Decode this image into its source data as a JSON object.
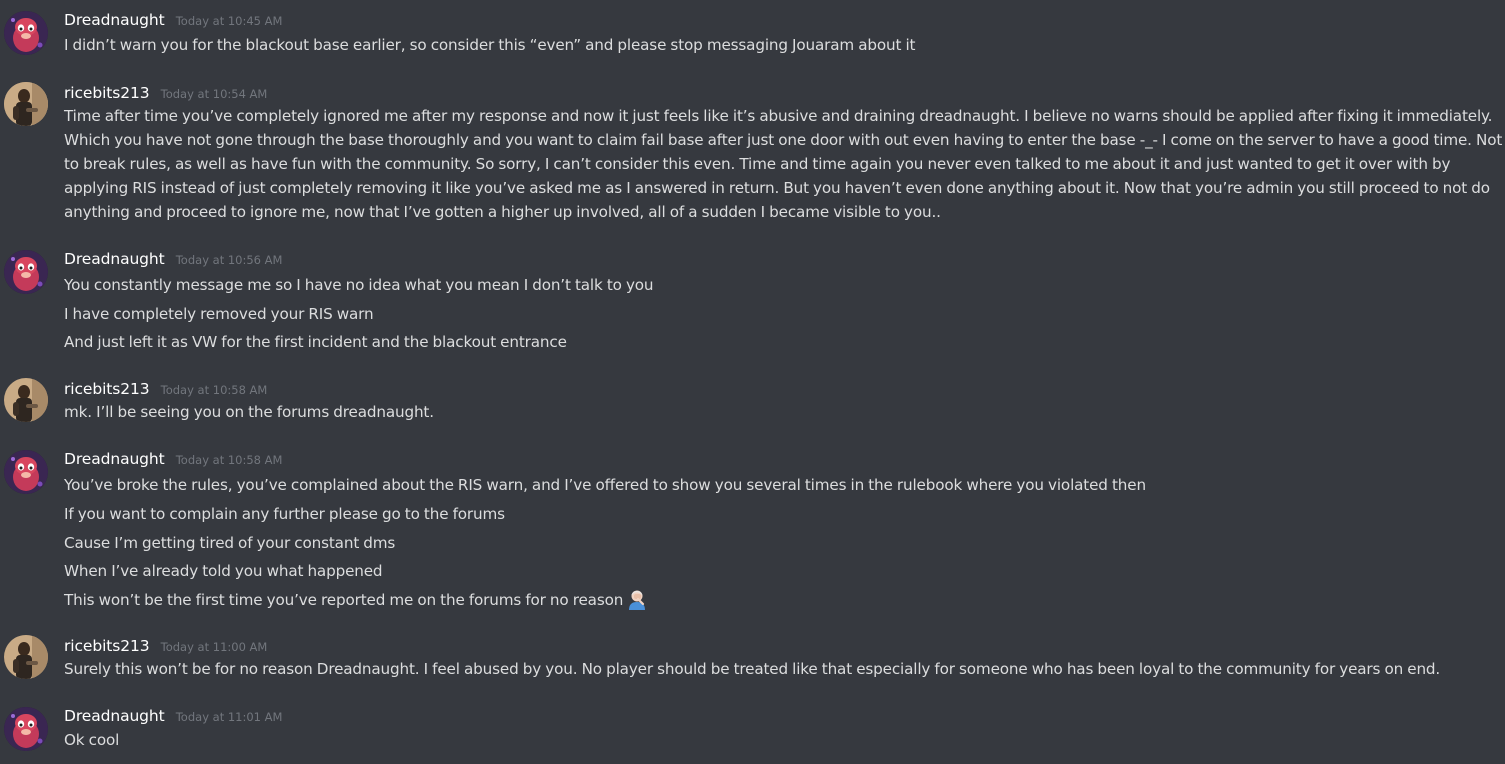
{
  "messages": [
    {
      "username": "Dreadnaught",
      "avatar": "dreadnaught-avatar",
      "timestamp": "Today at 10:45 AM",
      "lines": [
        "I didn’t warn you for the blackout base earlier, so consider this “even” and please stop messaging Jouaram about it"
      ]
    },
    {
      "username": "ricebits213",
      "avatar": "ricebits-avatar",
      "timestamp": "Today at 10:54 AM",
      "lines": [
        "Time after time you’ve completely ignored me after my response and now it just feels like it’s abusive and draining dreadnaught. I believe no warns should be applied after fixing it immediately.",
        "Which you have not gone through the base thoroughly and you want to claim fail base after just one door with out even having to enter the base -_- I come on the server to have a good time. Not",
        "to break rules, as well as have fun with the community. So sorry, I can’t consider this even. Time and time again you never even talked to me about it and just wanted to get it over with by",
        "applying RIS instead of just completely removing it like you’ve asked me as I answered in return. But you haven’t even done anything about it. Now that you’re admin you still proceed to not do",
        "anything and proceed to ignore me, now that I’ve gotten a higher up involved, all of a sudden I became visible to you.."
      ]
    },
    {
      "username": "Dreadnaught",
      "avatar": "dreadnaught-avatar",
      "timestamp": "Today at 10:56 AM",
      "lines": [
        "You constantly message me so I have no idea what you mean I don’t talk to you",
        "I have completely removed your RIS warn",
        "And just left it as VW for the first incident and the blackout entrance"
      ]
    },
    {
      "username": "ricebits213",
      "avatar": "ricebits-avatar",
      "timestamp": "Today at 10:58 AM",
      "lines": [
        "mk. I’ll be seeing you on the forums dreadnaught."
      ]
    },
    {
      "username": "Dreadnaught",
      "avatar": "dreadnaught-avatar",
      "timestamp": "Today at 10:58 AM",
      "lines": [
        "You’ve broke the rules, you’ve complained about the RIS warn, and I’ve offered to show you several times in the rulebook where you violated then",
        "If you want to complain any further please go to the forums",
        "Cause I’m getting tired of your constant dms",
        "When I’ve already told you what happened",
        "This won’t be the first time you’ve reported me on the forums for no reason"
      ],
      "emoji": "man-facepalming-emoji"
    },
    {
      "username": "ricebits213",
      "avatar": "ricebits-avatar",
      "timestamp": "Today at 11:00 AM",
      "lines": [
        "Surely this won’t be for no reason Dreadnaught. I feel abused by you. No player should be treated like that especially for someone who has been loyal to the community for years on end."
      ]
    },
    {
      "username": "Dreadnaught",
      "avatar": "dreadnaught-avatar",
      "timestamp": "Today at 11:01 AM",
      "lines": [
        "Ok cool"
      ]
    }
  ]
}
